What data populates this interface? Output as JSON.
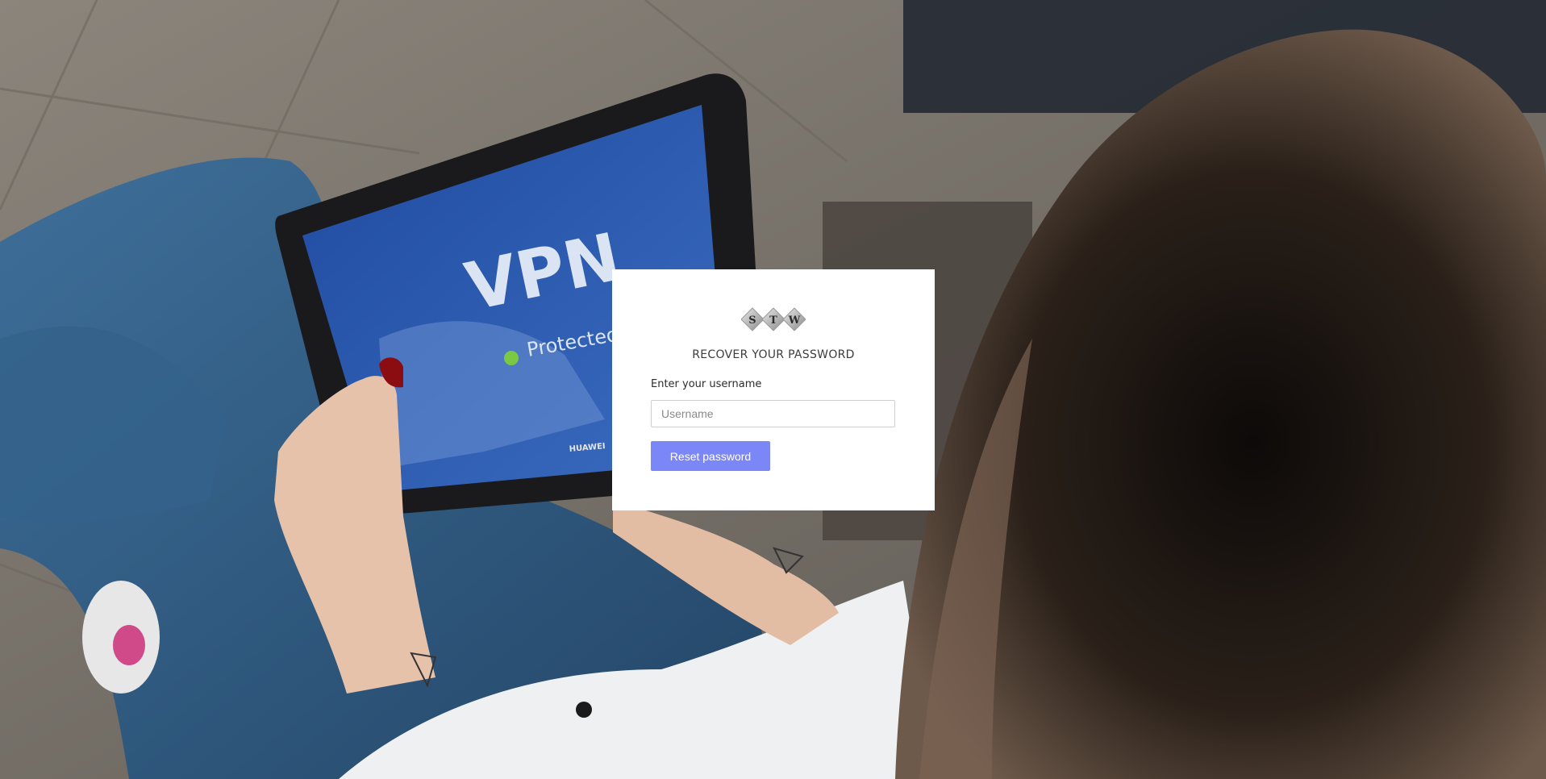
{
  "background": {
    "tablet_screen_title": "VPN",
    "tablet_screen_status": "Protected",
    "tablet_brand": "HUAWEI"
  },
  "logo": {
    "letters": [
      "S",
      "T",
      "W"
    ]
  },
  "form": {
    "title": "RECOVER YOUR PASSWORD",
    "username_label": "Enter your username",
    "username_placeholder": "Username",
    "username_value": "",
    "submit_label": "Reset password"
  },
  "colors": {
    "button_bg": "#7b86f7",
    "card_bg": "#ffffff",
    "tablet_screen": "#2f56a8",
    "status_dot": "#7ac943"
  },
  "icons": {
    "logo": "stw-diamond-logo",
    "status": "green-status-dot"
  }
}
